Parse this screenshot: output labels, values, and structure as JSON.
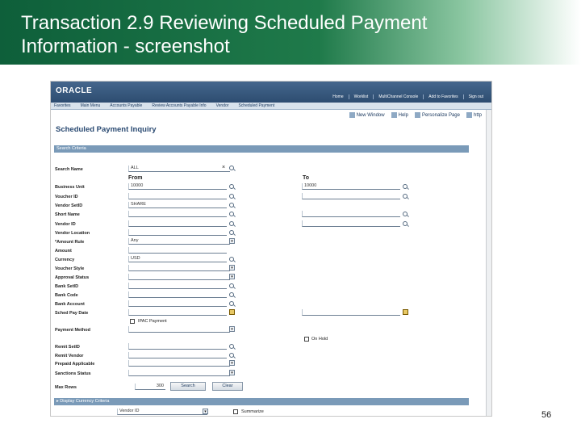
{
  "slide": {
    "title_line1": "Transaction 2.9 Reviewing Scheduled Payment",
    "title_line2": "Information - screenshot",
    "page_number": "56"
  },
  "app": {
    "logo": "ORACLE",
    "top_links": [
      "Home",
      "Worklist",
      "MultiChannel Console",
      "Add to Favorites",
      "Sign out"
    ],
    "nav": [
      "Favorites",
      "Main Menu",
      "Accounts Payable",
      "Review Accounts Payable Info",
      "Vendor",
      "Scheduled Payment"
    ],
    "page_links": [
      "New Window",
      "Help",
      "Personalize Page",
      "http"
    ],
    "page_title": "Scheduled Payment Inquiry"
  },
  "criteria": {
    "section_label": "Search Criteria",
    "from_label": "From",
    "to_label": "To",
    "search_name": {
      "label": "Search Name",
      "value": "ALL"
    },
    "business_unit": {
      "label": "Business Unit",
      "from": "10000",
      "to": "10000"
    },
    "voucher_id": {
      "label": "Voucher ID"
    },
    "vendor_setid": {
      "label": "Vendor SetID",
      "value": "SHARE"
    },
    "short_name": {
      "label": "Short Name"
    },
    "vendor_id": {
      "label": "Vendor ID"
    },
    "vendor_location": {
      "label": "Vendor Location"
    },
    "amount_rule": {
      "label": "*Amount Rule",
      "value": "Any"
    },
    "amount": {
      "label": "Amount"
    },
    "currency": {
      "label": "Currency",
      "value": "USD"
    },
    "voucher_style": {
      "label": "Voucher Style"
    },
    "approval_status": {
      "label": "Approval Status"
    },
    "bank_setid": {
      "label": "Bank SetID"
    },
    "bank_code": {
      "label": "Bank Code"
    },
    "bank_account": {
      "label": "Bank Account"
    },
    "sched_pay_date": {
      "label": "Sched Pay Date"
    },
    "ipac_payment": {
      "label": "IPAC Payment"
    },
    "payment_method": {
      "label": "Payment Method"
    },
    "on_hold": {
      "label": "On Hold"
    },
    "remit_setid": {
      "label": "Remit SetID"
    },
    "remit_vendor": {
      "label": "Remit Vendor"
    },
    "prepaid_applicable": {
      "label": "Prepaid Applicable"
    },
    "sanctions_status": {
      "label": "Sanctions Status"
    },
    "max_rows": {
      "label": "Max Rows",
      "value": "300"
    },
    "search_button": "Search",
    "clear_button": "Clear"
  },
  "currency_criteria": {
    "section_label": "Display Currency Criteria",
    "select_value": "Vendor ID",
    "checkbox_label": "Summarize"
  }
}
